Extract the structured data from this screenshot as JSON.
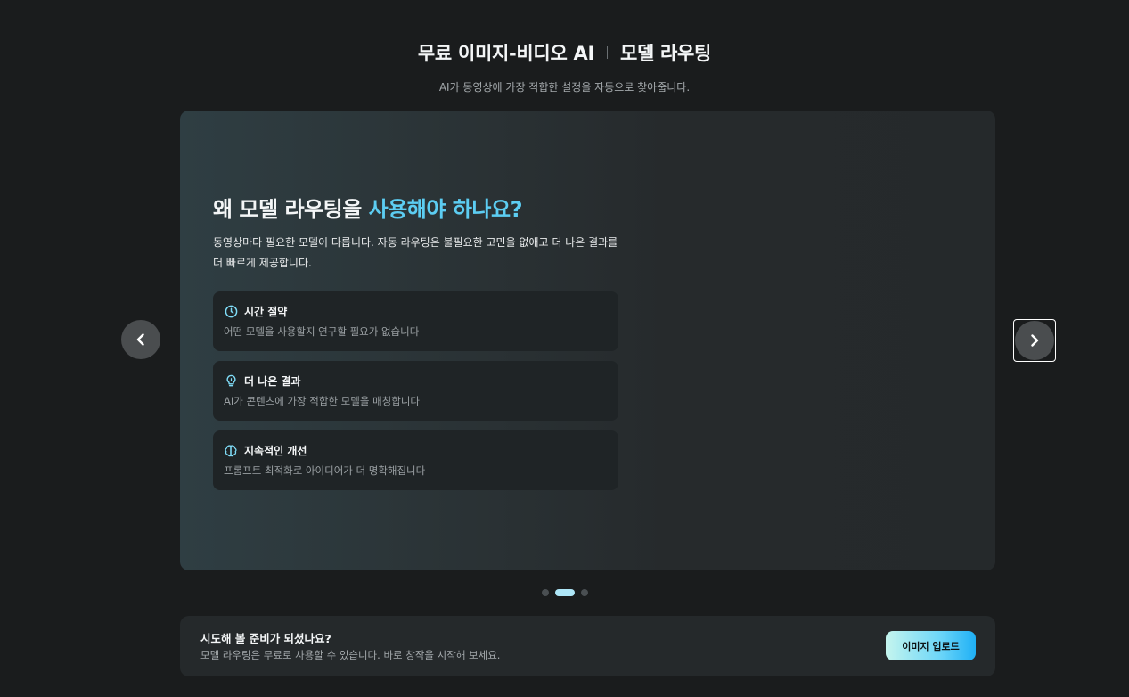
{
  "header": {
    "title_left": "무료 이미지-비디오 AI",
    "title_right": "모델 라우팅",
    "subtitle": "AI가 동영상에 가장 적합한 설정을 자동으로 찾아줍니다."
  },
  "slide": {
    "heading_white": "왜 모델 라우팅을 ",
    "heading_blue": "사용해야",
    "heading_end": " 하나요?",
    "description": "동영상마다 필요한 모델이 다릅니다. 자동 라우팅은 불필요한 고민을 없애고 더 나은 결과를 더 빠르게 제공합니다.",
    "features": [
      {
        "icon": "clock-icon",
        "title": "시간 절약",
        "desc": "어떤 모델을 사용할지 연구할 필요가 없습니다"
      },
      {
        "icon": "lightbulb-icon",
        "title": "더 나은 결과",
        "desc": "AI가 콘텐츠에 가장 적합한 모델을 매칭합니다"
      },
      {
        "icon": "brain-icon",
        "title": "지속적인 개선",
        "desc": "프롬프트 최적화로 아이디어가 더 명확해집니다"
      }
    ]
  },
  "carousel": {
    "prev_icon": "chevron-left-icon",
    "next_icon": "chevron-right-icon",
    "total_slides": 3,
    "active_slide": 2
  },
  "cta": {
    "title": "시도해 볼 준비가 되셨나요?",
    "description": "모델 라우팅은 무료로 사용할 수 있습니다. 바로 창작을 시작해 보세요.",
    "button_label": "이미지 업로드"
  },
  "colors": {
    "accent_blue": "#5ccdf2",
    "background": "#1a1c1d",
    "button_gradient_start": "#c5f5ee",
    "button_gradient_end": "#1fb0f5"
  }
}
